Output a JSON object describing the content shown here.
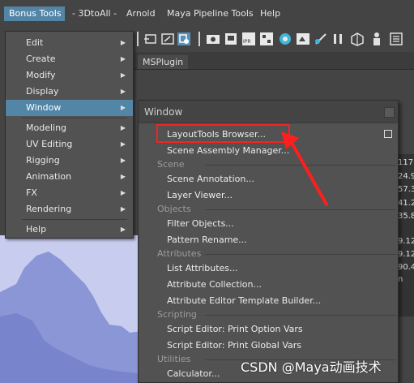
{
  "menubar": {
    "items": [
      "Bonus Tools",
      "- 3DtoAll -",
      "Arnold",
      "Maya Pipeline Tools",
      "Help"
    ]
  },
  "shelf": {
    "tab_label": "MSPlugin"
  },
  "bonus_menu": {
    "items": [
      {
        "label": "Edit",
        "has_submenu": true
      },
      {
        "label": "Create",
        "has_submenu": true
      },
      {
        "label": "Modify",
        "has_submenu": true
      },
      {
        "label": "Display",
        "has_submenu": true
      },
      {
        "label": "Window",
        "has_submenu": true,
        "active": true
      },
      {
        "label": "Modeling",
        "has_submenu": true
      },
      {
        "label": "UV Editing",
        "has_submenu": true
      },
      {
        "label": "Rigging",
        "has_submenu": true
      },
      {
        "label": "Animation",
        "has_submenu": true
      },
      {
        "label": "FX",
        "has_submenu": true
      },
      {
        "label": "Rendering",
        "has_submenu": true
      },
      {
        "label": "Help",
        "has_submenu": true
      }
    ]
  },
  "window_menu": {
    "title": "Window",
    "items": [
      "LayoutTools Browser...",
      "Scene Assembly Manager...",
      "Scene Annotation...",
      "Layer Viewer...",
      "Filter Objects...",
      "Pattern Rename...",
      "List Attributes...",
      "Attribute Collection...",
      "Attribute Editor Template Builder...",
      "Script Editor:  Print Option Vars",
      "Script Editor:  Print Global Vars",
      "Calculator..."
    ],
    "sections": [
      "Scene",
      "Objects",
      "Attributes",
      "Scripting",
      "Utilities"
    ]
  },
  "side_values": [
    "117.",
    "24.9",
    "57.3",
    "41.2",
    "35.8",
    "9.12",
    "9.12",
    "90.4",
    "n"
  ],
  "watermark": "CSDN @Maya动画技术",
  "colors": {
    "accent": "#5285a6",
    "highlight_box": "#ff1e1e",
    "viewport": "#c7ccee"
  }
}
